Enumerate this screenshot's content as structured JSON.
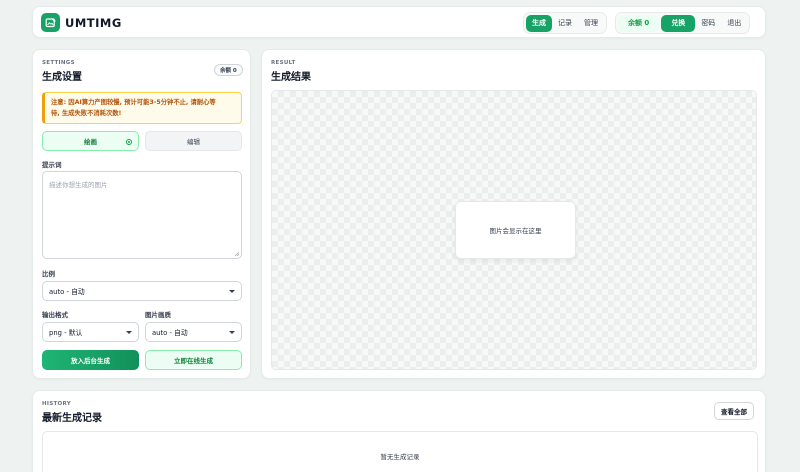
{
  "header": {
    "brand": "UMTIMG",
    "nav": [
      "生成",
      "记录",
      "管理"
    ],
    "balance": "余额 0",
    "redeem": "兑换",
    "password": "密码",
    "logout": "退出"
  },
  "settings": {
    "eyebrow": "SETTINGS",
    "title": "生成设置",
    "balance_chip": "余额 0",
    "notice_line1": "注意: 因AI算力产图较慢, 预计可能3-5分钟不止, 请耐心等",
    "notice_line2": "待, 生成失败不消耗次数!",
    "mode_draw": "绘画",
    "mode_edit": "编辑",
    "prompt_label": "提示词",
    "prompt_placeholder": "描述你想生成的图片",
    "ratio_label": "比例",
    "ratio_value": "auto - 自动",
    "format_label": "输出格式",
    "format_value": "png - 默认",
    "quality_label": "图片画质",
    "quality_value": "auto - 自动",
    "btn_background": "放入后台生成",
    "btn_now": "立即在线生成"
  },
  "result": {
    "eyebrow": "RESULT",
    "title": "生成结果",
    "placeholder": "图片会显示在这里"
  },
  "history": {
    "eyebrow": "HISTORY",
    "title": "最新生成记录",
    "view_all": "查看全部",
    "empty": "暂无生成记录"
  },
  "colors": {
    "accent": "#17a266",
    "notice_bg": "#fffbeb",
    "notice_text": "#b45309"
  },
  "icons": {
    "logo": "image-edit-icon"
  }
}
